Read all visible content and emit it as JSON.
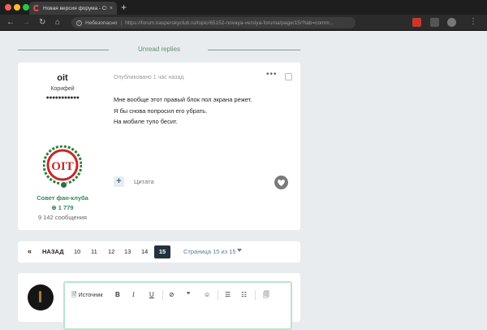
{
  "browser": {
    "tab_title": "Новая версия форума - Стр",
    "tab_close": "×",
    "new_tab": "+",
    "address": {
      "insecure_label": "Небезопасно",
      "separator": "|",
      "url": "https://forum.kasperskyclub.ru/topic/65152-novaya-versiya-foruma/page/15/?tab=comm..."
    },
    "nav": {
      "back": "←",
      "forward": "→",
      "reload": "↻",
      "home": "⌂"
    }
  },
  "thread": {
    "unread_label": "Unread replies"
  },
  "post": {
    "author": {
      "name": "oit",
      "rank": "Корифей",
      "rank_pips": "●●●●●●●●●●●",
      "group": "Совет фан-клуба",
      "reputation": "1 779",
      "post_count": "9 142 сообщения"
    },
    "meta": "Опубликовано 1 час назад",
    "menu": "•••",
    "body": [
      "Мне вообще этот правый блок пол экрана режет.",
      "Я бы снова попросил его убрать.",
      "На мобиле тупо бесит."
    ],
    "quote_plus": "+",
    "quote_label": "Цитата"
  },
  "pagination": {
    "first": "«",
    "prev": "НАЗАД",
    "pages": [
      "10",
      "11",
      "12",
      "13",
      "14"
    ],
    "current": "15",
    "total": "Страница 15 из 15"
  },
  "editor": {
    "source_label": "Источник",
    "bold": "B",
    "italic": "I",
    "underline": "U",
    "link": "⊘",
    "quote": "❞",
    "emoji": "☺"
  },
  "colors": {
    "accent_green": "#2e8b57",
    "divider_green": "#76a48f",
    "active_page": "#23323d"
  }
}
